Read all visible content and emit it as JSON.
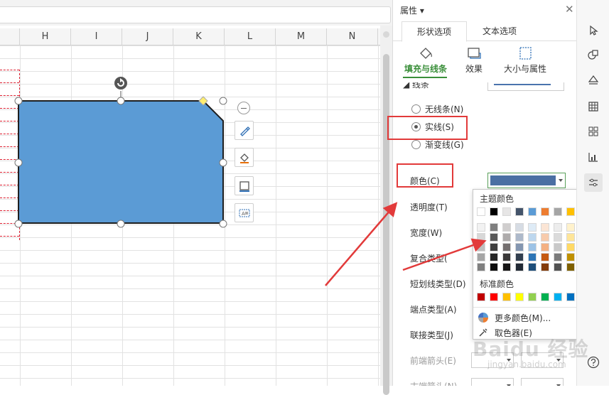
{
  "spreadsheet": {
    "columns": [
      "H",
      "I",
      "J",
      "K",
      "L",
      "M",
      "N"
    ]
  },
  "panel": {
    "title": "属性",
    "tabs": [
      "形状选项",
      "文本选项"
    ],
    "subtabs": [
      "填充与线条",
      "效果",
      "大小与属性"
    ],
    "section": "线条",
    "line_options": [
      {
        "label": "无线条(N)",
        "checked": false
      },
      {
        "label": "实线(S)",
        "checked": true
      },
      {
        "label": "渐变线(G)",
        "checked": false
      }
    ],
    "properties": [
      "颜色(C)",
      "透明度(T)",
      "宽度(W)",
      "复合类型(",
      "短划线类型(D)",
      "端点类型(A)",
      "联接类型(J)",
      "前端箭头(E)",
      "末端箭头(N)"
    ],
    "current_line_color": "#4a6fa3"
  },
  "color_popup": {
    "theme_title": "主题颜色",
    "theme_top": [
      "#ffffff",
      "#000000",
      "#e7e6e6",
      "#44546a",
      "#5b9bd5",
      "#ed7d31",
      "#a5a5a5",
      "#ffc000",
      "#4472c4",
      "#70ad47"
    ],
    "theme_tints": [
      [
        "#f2f2f2",
        "#7f7f7f",
        "#d0cece",
        "#d6dce4",
        "#deebf6",
        "#fbe5d5",
        "#ededed",
        "#fff2cc",
        "#d9e2f3",
        "#e2efd9"
      ],
      [
        "#d8d8d8",
        "#595959",
        "#aeabab",
        "#adb9ca",
        "#bdd7ee",
        "#f7cbac",
        "#dbdbdb",
        "#fee599",
        "#b4c6e7",
        "#c5e0b3"
      ],
      [
        "#bfbfbf",
        "#3f3f3f",
        "#757070",
        "#8496b0",
        "#9dc3e6",
        "#f4b183",
        "#c9c9c9",
        "#ffd965",
        "#8eaadb",
        "#a8d08d"
      ],
      [
        "#a5a5a5",
        "#262626",
        "#3a3838",
        "#323f4f",
        "#2e75b5",
        "#c55a11",
        "#7b7b7b",
        "#bf9000",
        "#2f5496",
        "#538135"
      ],
      [
        "#7f7f7f",
        "#0c0c0c",
        "#171616",
        "#222a35",
        "#1e4e79",
        "#833c0b",
        "#525252",
        "#7f6000",
        "#1f3864",
        "#375623"
      ]
    ],
    "standard_title": "标准颜色",
    "standard": [
      "#c00000",
      "#ff0000",
      "#ffc000",
      "#ffff00",
      "#92d050",
      "#00b050",
      "#00b0f0",
      "#0070c0",
      "#002060",
      "#7030a0"
    ],
    "more_colors": "更多颜色(M)...",
    "eyedropper": "取色器(E)"
  },
  "watermark": {
    "brand": "Baidu 经验",
    "url": "jingyan.baidu.com"
  },
  "colors": {
    "shape_fill": "#5b9bd5",
    "shape_stroke": "#1f1f1f",
    "accent_green": "#3a8f3a",
    "highlight_red": "#e23a3a"
  }
}
